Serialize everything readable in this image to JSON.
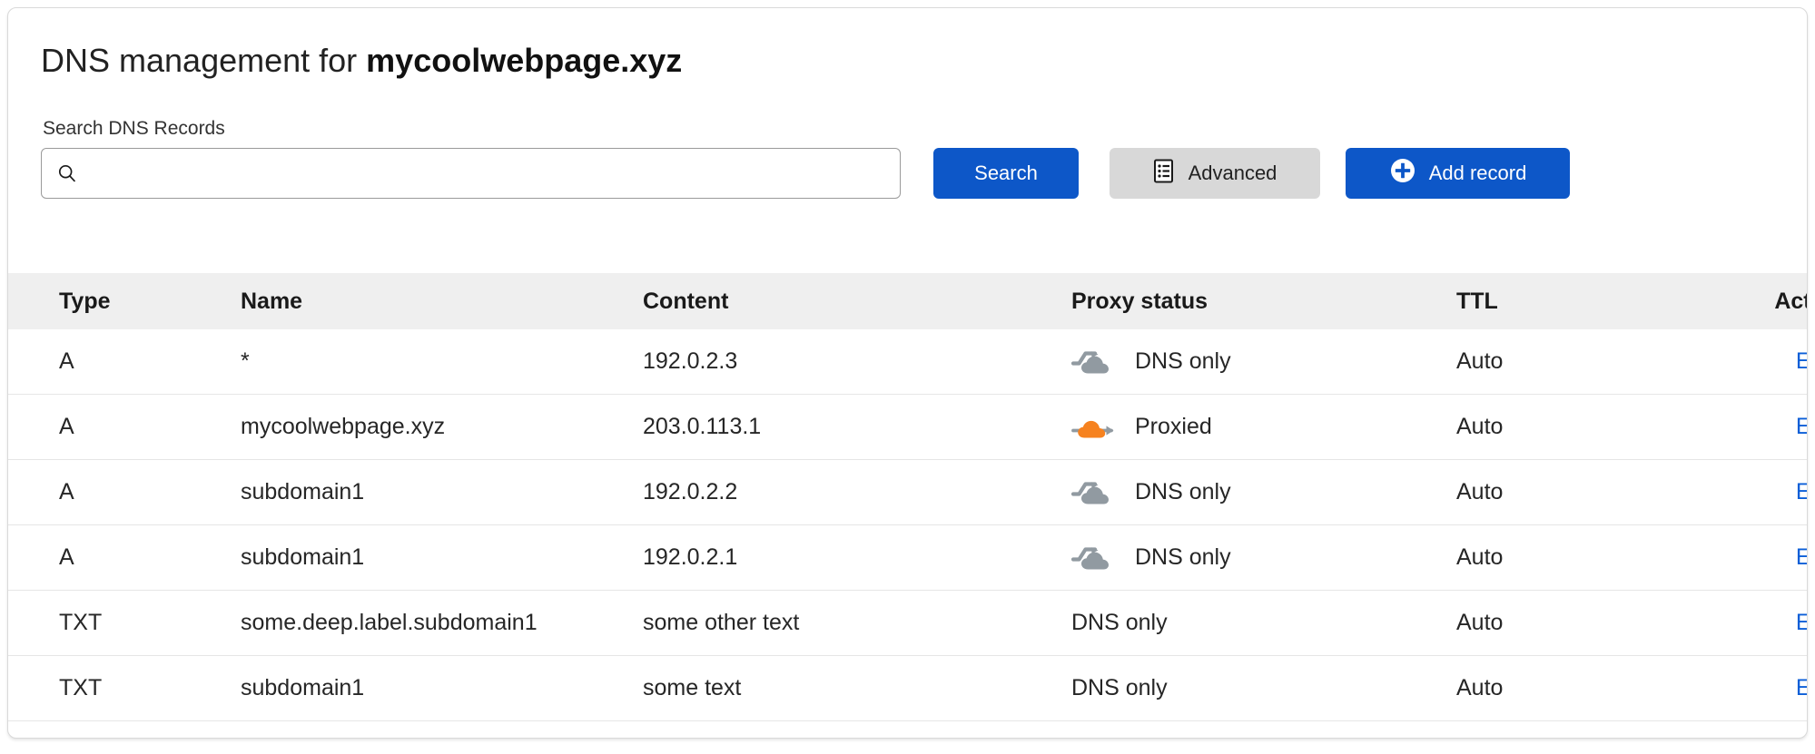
{
  "card": {
    "title_prefix": "DNS management for ",
    "domain": "mycoolwebpage.xyz"
  },
  "search": {
    "label": "Search DNS Records",
    "value": "",
    "placeholder": "",
    "icon": "search-icon",
    "search_button": "Search",
    "advanced_button": "Advanced",
    "advanced_icon": "list-document-icon",
    "add_button": "Add record",
    "add_icon": "plus-circle-icon"
  },
  "colors": {
    "primary_blue": "#0d57c8",
    "link_blue": "#0b5ed7",
    "advanced_gray": "#d8d8d8",
    "header_gray": "#efefef",
    "proxied_orange": "#f6821f",
    "dns_only_gray": "#919aa1"
  },
  "table": {
    "headers": [
      "Type",
      "Name",
      "Content",
      "Proxy status",
      "TTL",
      "Actions"
    ],
    "rows": [
      {
        "type": "A",
        "name": "*",
        "content": "192.0.2.3",
        "proxy_status": "DNS only",
        "proxy_icon": "cloud-dns-only-icon",
        "ttl": "Auto",
        "action": "Edit"
      },
      {
        "type": "A",
        "name": "mycoolwebpage.xyz",
        "content": "203.0.113.1",
        "proxy_status": "Proxied",
        "proxy_icon": "cloud-proxied-icon",
        "ttl": "Auto",
        "action": "Edit"
      },
      {
        "type": "A",
        "name": "subdomain1",
        "content": "192.0.2.2",
        "proxy_status": "DNS only",
        "proxy_icon": "cloud-dns-only-icon",
        "ttl": "Auto",
        "action": "Edit"
      },
      {
        "type": "A",
        "name": "subdomain1",
        "content": "192.0.2.1",
        "proxy_status": "DNS only",
        "proxy_icon": "cloud-dns-only-icon",
        "ttl": "Auto",
        "action": "Edit"
      },
      {
        "type": "TXT",
        "name": "some.deep.label.subdomain1",
        "content": "some other text",
        "proxy_status": "DNS only",
        "proxy_icon": "none",
        "ttl": "Auto",
        "action": "Edit"
      },
      {
        "type": "TXT",
        "name": "subdomain1",
        "content": "some text",
        "proxy_status": "DNS only",
        "proxy_icon": "none",
        "ttl": "Auto",
        "action": "Edit"
      }
    ]
  }
}
